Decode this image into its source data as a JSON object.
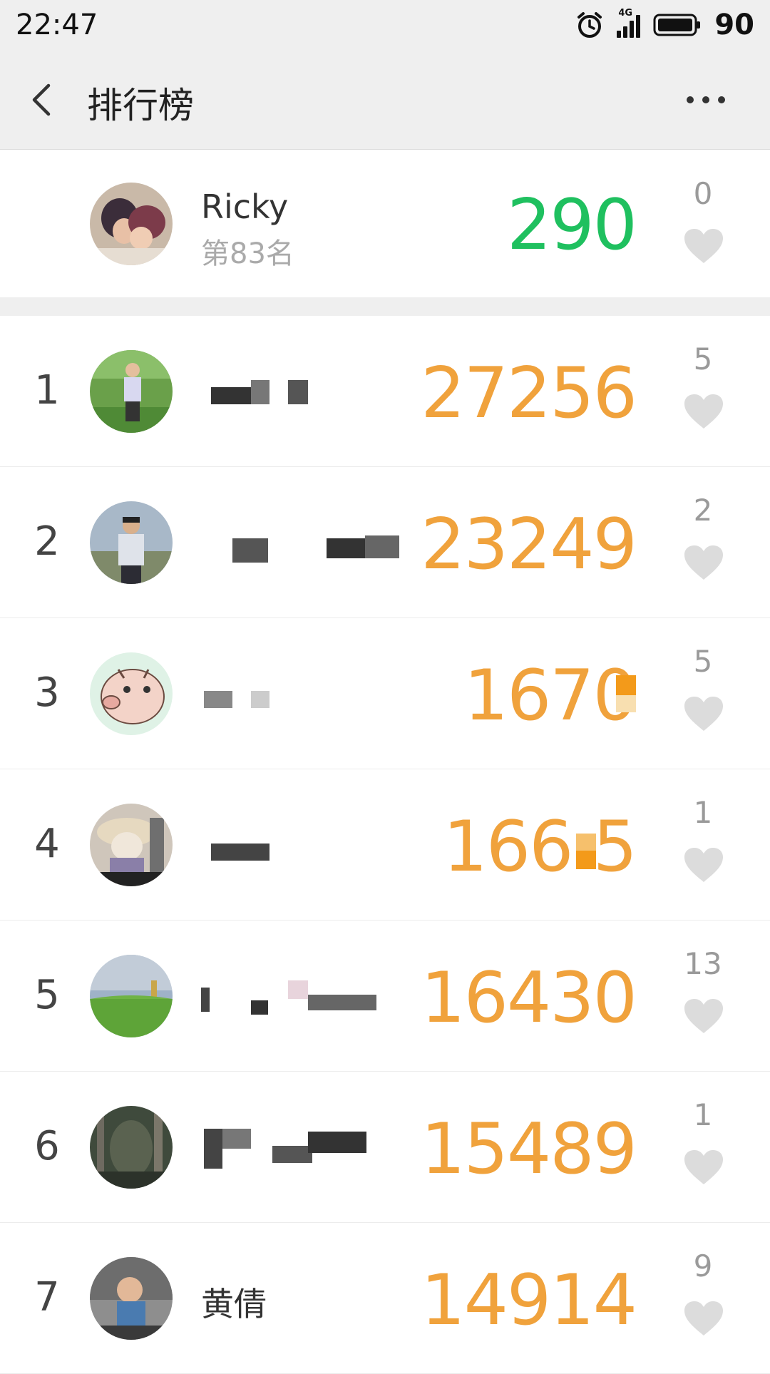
{
  "status_bar": {
    "time": "22:47",
    "network": "4G",
    "battery": "90",
    "icons": [
      "alarm-icon",
      "signal-icon",
      "battery-icon"
    ]
  },
  "header": {
    "title": "排行榜",
    "back_icon": "chevron-left-icon",
    "more_icon": "more-dots-icon"
  },
  "me": {
    "name": "Ricky",
    "rank_text": "第83名",
    "score": "290",
    "likes": "0"
  },
  "ranking": [
    {
      "rank": "1",
      "name": "",
      "score": "27256",
      "likes": "5"
    },
    {
      "rank": "2",
      "name": "",
      "score": "23249",
      "likes": "2"
    },
    {
      "rank": "3",
      "name": "",
      "score": "1670",
      "likes": "5"
    },
    {
      "rank": "4",
      "name": "",
      "score": "166 5",
      "likes": "1"
    },
    {
      "rank": "5",
      "name": "",
      "score": "16430",
      "likes": "13"
    },
    {
      "rank": "6",
      "name": "",
      "score": "15489",
      "likes": "1"
    },
    {
      "rank": "7",
      "name": "黄倩",
      "score": "14914",
      "likes": "9"
    }
  ],
  "colors": {
    "my_score": "#1fc05f",
    "score": "#f0a23c",
    "heart": "#dcdcdc",
    "header_bg": "#efefef"
  }
}
